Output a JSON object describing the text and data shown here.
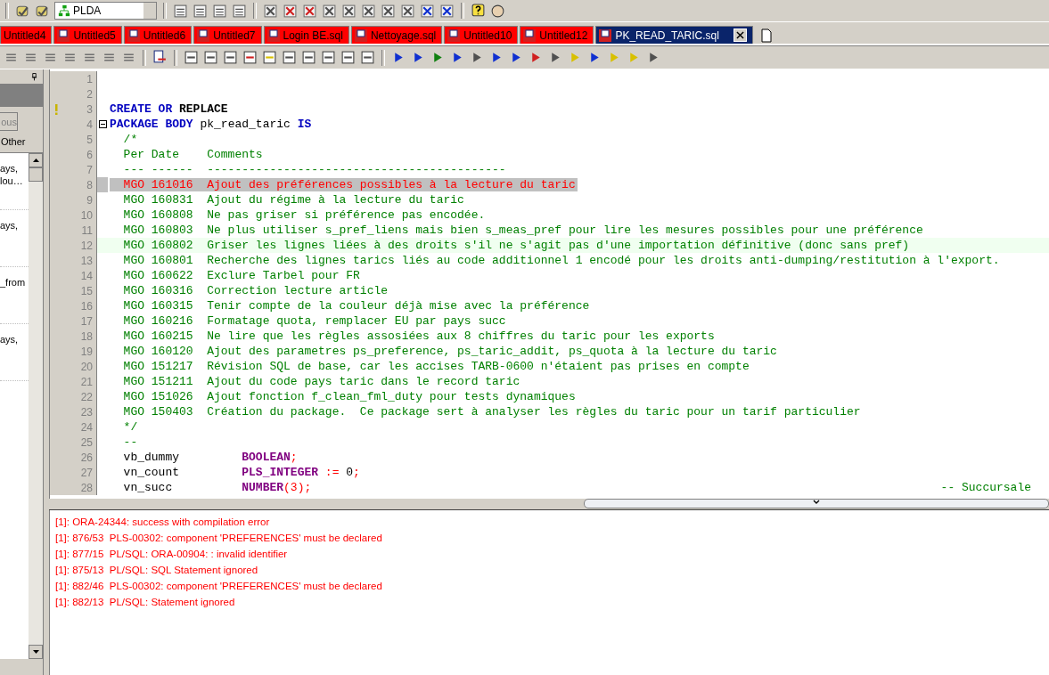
{
  "toolbar": {
    "connection": "PLDA"
  },
  "tabs": [
    {
      "label": "Untitled4",
      "selected": false,
      "kind": "plain"
    },
    {
      "label": "Untitled5",
      "selected": false,
      "kind": "sql"
    },
    {
      "label": "Untitled6",
      "selected": false,
      "kind": "sql"
    },
    {
      "label": "Untitled7",
      "selected": false,
      "kind": "sql"
    },
    {
      "label": "Login BE.sql",
      "selected": false,
      "kind": "sql"
    },
    {
      "label": "Nettoyage.sql",
      "selected": false,
      "kind": "sql"
    },
    {
      "label": "Untitled10",
      "selected": false,
      "kind": "sql"
    },
    {
      "label": "Untitled12",
      "selected": false,
      "kind": "sql"
    },
    {
      "label": "PK_READ_TARIC.sql",
      "selected": true,
      "kind": "sql"
    }
  ],
  "side_panel": {
    "button": "ous",
    "label": "Other",
    "items": [
      "ays,\nlou…",
      "ays,",
      "_from",
      "ays,"
    ]
  },
  "editor": {
    "lines": [
      {
        "number": "1",
        "marker": false,
        "fold": false,
        "highlighted": false,
        "current": false
      },
      {
        "number": "2",
        "marker": false,
        "fold": false,
        "highlighted": false,
        "current": false
      },
      {
        "number": "3",
        "marker": true,
        "fold": false,
        "highlighted": false,
        "current": false,
        "tokens": [
          {
            "kind": "keyword",
            "text": "CREATE"
          },
          {
            "kind": "keyword",
            "text": " OR"
          },
          {
            "kind": "strong",
            "text": " REPLACE"
          }
        ]
      },
      {
        "number": "4",
        "marker": false,
        "fold": true,
        "highlighted": false,
        "current": false,
        "tokens": [
          {
            "kind": "keyword",
            "text": "PACKAGE BODY"
          },
          {
            "kind": "plain",
            "text": " pk_read_taric "
          },
          {
            "kind": "keyword",
            "text": "IS"
          }
        ]
      },
      {
        "number": "5",
        "marker": false,
        "fold": false,
        "highlighted": false,
        "current": false,
        "tokens": [
          {
            "kind": "comment",
            "text": "  /*"
          }
        ]
      },
      {
        "number": "6",
        "marker": false,
        "fold": false,
        "highlighted": false,
        "current": false,
        "tokens": [
          {
            "kind": "comment",
            "text": "  Per Date    Comments"
          }
        ]
      },
      {
        "number": "7",
        "marker": false,
        "fold": false,
        "highlighted": false,
        "current": false,
        "tokens": [
          {
            "kind": "comment",
            "text": "  --- ------  -------------------------------------------"
          }
        ]
      },
      {
        "number": "8",
        "marker": false,
        "fold": false,
        "highlighted": true,
        "current": false,
        "tokens": [
          {
            "kind": "comment",
            "text": "  MGO 161016  Ajout des préférences possibles à la lecture du taric"
          }
        ]
      },
      {
        "number": "9",
        "marker": false,
        "fold": false,
        "highlighted": false,
        "current": false,
        "tokens": [
          {
            "kind": "comment",
            "text": "  MGO 160831  Ajout du régime à la lecture du taric"
          }
        ]
      },
      {
        "number": "10",
        "marker": false,
        "fold": false,
        "highlighted": false,
        "current": false,
        "tokens": [
          {
            "kind": "comment",
            "text": "  MGO 160808  Ne pas griser si préférence pas encodée."
          }
        ]
      },
      {
        "number": "11",
        "marker": false,
        "fold": false,
        "highlighted": false,
        "current": false,
        "tokens": [
          {
            "kind": "comment",
            "text": "  MGO 160803  Ne plus utiliser s_pref_liens mais bien s_meas_pref pour lire les mesures possibles pour une préférence"
          }
        ]
      },
      {
        "number": "12",
        "marker": false,
        "fold": false,
        "highlighted": false,
        "current": true,
        "tokens": [
          {
            "kind": "comment",
            "text": "  MGO 160802  Griser les lignes liées à des droits s'il ne s'agit pas d'une importation définitive (donc sans pref)"
          }
        ]
      },
      {
        "number": "13",
        "marker": false,
        "fold": false,
        "highlighted": false,
        "current": false,
        "tokens": [
          {
            "kind": "comment",
            "text": "  MGO 160801  Recherche des lignes tarics liés au code additionnel 1 encodé pour les droits anti-dumping/restitution à l'export."
          }
        ]
      },
      {
        "number": "14",
        "marker": false,
        "fold": false,
        "highlighted": false,
        "current": false,
        "tokens": [
          {
            "kind": "comment",
            "text": "  MGO 160622  Exclure Tarbel pour FR"
          }
        ]
      },
      {
        "number": "15",
        "marker": false,
        "fold": false,
        "highlighted": false,
        "current": false,
        "tokens": [
          {
            "kind": "comment",
            "text": "  MGO 160316  Correction lecture article"
          }
        ]
      },
      {
        "number": "16",
        "marker": false,
        "fold": false,
        "highlighted": false,
        "current": false,
        "tokens": [
          {
            "kind": "comment",
            "text": "  MGO 160315  Tenir compte de la couleur déjà mise avec la préférence"
          }
        ]
      },
      {
        "number": "17",
        "marker": false,
        "fold": false,
        "highlighted": false,
        "current": false,
        "tokens": [
          {
            "kind": "comment",
            "text": "  MGO 160216  Formatage quota, remplacer EU par pays succ"
          }
        ]
      },
      {
        "number": "18",
        "marker": false,
        "fold": false,
        "highlighted": false,
        "current": false,
        "tokens": [
          {
            "kind": "comment",
            "text": "  MGO 160215  Ne lire que les règles assosiées aux 8 chiffres du taric pour les exports"
          }
        ]
      },
      {
        "number": "19",
        "marker": false,
        "fold": false,
        "highlighted": false,
        "current": false,
        "tokens": [
          {
            "kind": "comment",
            "text": "  MGO 160120  Ajout des parametres ps_preference, ps_taric_addit, ps_quota à la lecture du taric"
          }
        ]
      },
      {
        "number": "20",
        "marker": false,
        "fold": false,
        "highlighted": false,
        "current": false,
        "tokens": [
          {
            "kind": "comment",
            "text": "  MGO 151217  Révision SQL de base, car les accises TARB-0600 n'étaient pas prises en compte"
          }
        ]
      },
      {
        "number": "21",
        "marker": false,
        "fold": false,
        "highlighted": false,
        "current": false,
        "tokens": [
          {
            "kind": "comment",
            "text": "  MGO 151211  Ajout du code pays taric dans le record taric"
          }
        ]
      },
      {
        "number": "22",
        "marker": false,
        "fold": false,
        "highlighted": false,
        "current": false,
        "tokens": [
          {
            "kind": "comment",
            "text": "  MGO 151026  Ajout fonction f_clean_fml_duty pour tests dynamiques"
          }
        ]
      },
      {
        "number": "23",
        "marker": false,
        "fold": false,
        "highlighted": false,
        "current": false,
        "tokens": [
          {
            "kind": "comment",
            "text": "  MGO 150403  Création du package.  Ce package sert à analyser les règles du taric pour un tarif particulier"
          }
        ]
      },
      {
        "number": "24",
        "marker": false,
        "fold": false,
        "highlighted": false,
        "current": false,
        "tokens": [
          {
            "kind": "comment",
            "text": "  */"
          }
        ]
      },
      {
        "number": "25",
        "marker": false,
        "fold": false,
        "highlighted": false,
        "current": false,
        "tokens": [
          {
            "kind": "comment",
            "text": "  --"
          }
        ]
      },
      {
        "number": "26",
        "marker": false,
        "fold": false,
        "highlighted": false,
        "current": false,
        "tokens": [
          {
            "kind": "plain",
            "text": "  vb_dummy         "
          },
          {
            "kind": "type",
            "text": "BOOLEAN"
          },
          {
            "kind": "operator",
            "text": ";"
          }
        ]
      },
      {
        "number": "27",
        "marker": false,
        "fold": false,
        "highlighted": false,
        "current": false,
        "tokens": [
          {
            "kind": "plain",
            "text": "  vn_count         "
          },
          {
            "kind": "type",
            "text": "PLS_INTEGER"
          },
          {
            "kind": "operator",
            "text": " :="
          },
          {
            "kind": "plain",
            "text": " 0"
          },
          {
            "kind": "operator",
            "text": ";"
          }
        ]
      },
      {
        "number": "28",
        "marker": false,
        "fold": false,
        "highlighted": false,
        "current": false,
        "tokens": [
          {
            "kind": "plain",
            "text": "  vn_succ          "
          },
          {
            "kind": "type",
            "text": "NUMBER"
          },
          {
            "kind": "operator",
            "text": "(3);"
          },
          {
            "kind": "comment_right",
            "text": "-- Succursale"
          }
        ]
      }
    ]
  },
  "messages": [
    "[1]: ORA-24344: success with compilation error",
    "[1]: 876/53  PLS-00302: component 'PREFERENCES' must be declared",
    "[1]: 877/15  PL/SQL: ORA-00904: : invalid identifier",
    "[1]: 875/13  PL/SQL: SQL Statement ignored",
    "[1]: 882/46  PLS-00302: component 'PREFERENCES' must be declared",
    "[1]: 882/13  PL/SQL: Statement ignored"
  ]
}
